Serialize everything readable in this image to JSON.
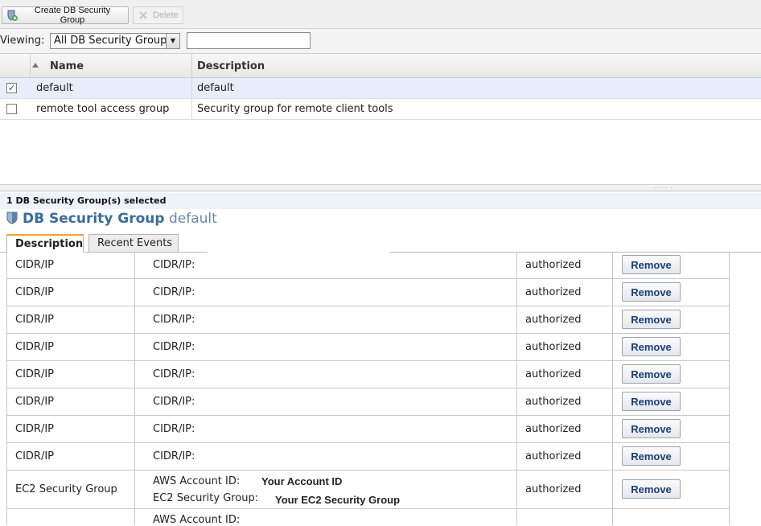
{
  "toolbar": {
    "create_label": "Create DB Security Group",
    "delete_label": "Delete"
  },
  "viewing": {
    "label": "Viewing:",
    "selected": "All DB Security Groups",
    "search_value": ""
  },
  "grid": {
    "columns": [
      "Name",
      "Description"
    ],
    "rows": [
      {
        "checked": true,
        "check_mark": "✓",
        "name": "default",
        "description": "default"
      },
      {
        "checked": false,
        "check_mark": "",
        "name": "remote tool access group",
        "description": "Security group for remote client tools"
      }
    ]
  },
  "status": {
    "selected_text": "1 DB Security Group(s) selected"
  },
  "detail": {
    "title_strong": "DB Security Group",
    "title_name": "default",
    "tabs": [
      "Description",
      "Recent Events"
    ],
    "rows": [
      {
        "type": "CIDR/IP",
        "label": "CIDR/IP:",
        "status": "authorized",
        "action": "Remove"
      },
      {
        "type": "CIDR/IP",
        "label": "CIDR/IP:",
        "status": "authorized",
        "action": "Remove"
      },
      {
        "type": "CIDR/IP",
        "label": "CIDR/IP:",
        "status": "authorized",
        "action": "Remove"
      },
      {
        "type": "CIDR/IP",
        "label": "CIDR/IP:",
        "status": "authorized",
        "action": "Remove"
      },
      {
        "type": "CIDR/IP",
        "label": "CIDR/IP:",
        "status": "authorized",
        "action": "Remove"
      },
      {
        "type": "CIDR/IP",
        "label": "CIDR/IP:",
        "status": "authorized",
        "action": "Remove"
      },
      {
        "type": "CIDR/IP",
        "label": "CIDR/IP:",
        "status": "authorized",
        "action": "Remove"
      },
      {
        "type": "CIDR/IP",
        "label": "CIDR/IP:",
        "status": "authorized",
        "action": "Remove"
      }
    ],
    "ec2_row": {
      "type": "EC2 Security Group",
      "account_label": "AWS Account ID:",
      "account_value": "Your Account ID",
      "group_label": "EC2 Security Group:",
      "group_value": "Your EC2 Security Group",
      "status": "authorized",
      "action": "Remove"
    },
    "partial_row": {
      "account_label": "AWS Account ID:"
    }
  },
  "colors": {
    "title_blue": "#3a6c9c",
    "remove_text": "#1b3d7a",
    "tab_accent": "#f0a030",
    "selected_row": "#e6eefa"
  }
}
